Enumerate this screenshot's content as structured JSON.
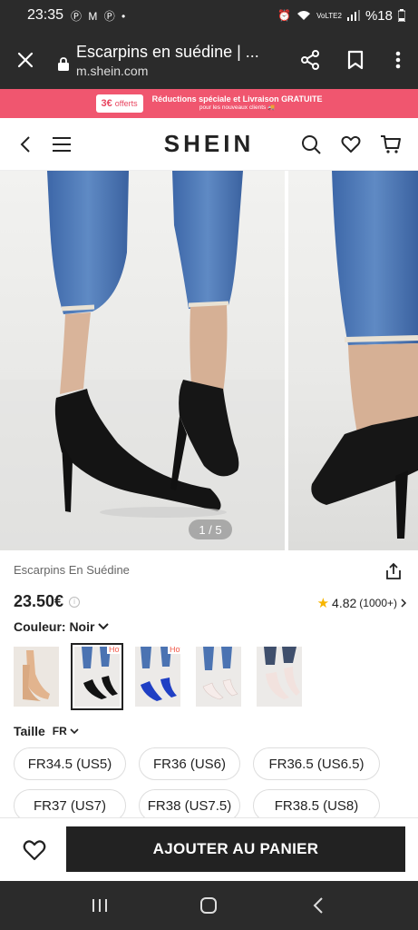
{
  "status_bar": {
    "time": "23:35",
    "notifications": "Ⓟ M Ⓟ •",
    "network": "VoLTE2",
    "battery": "%18"
  },
  "browser": {
    "page_title": "Escarpins en suédine | ...",
    "url": "m.shein.com"
  },
  "promo": {
    "badge_amount": "3€",
    "badge_text": "offerts",
    "line1": "Réductions spéciale et Livraison GRATUITE",
    "line2": "pour les nouveaux clients"
  },
  "header": {
    "brand": "SHEIN"
  },
  "gallery": {
    "counter": "1 / 5"
  },
  "product": {
    "title": "Escarpins En Suédine",
    "price": "23.50€",
    "info_icon": "i",
    "rating": "4.82",
    "rating_count": "(1000+)",
    "color_label": "Couleur: Noir",
    "swatches": [
      {
        "name": "nude",
        "hot": ""
      },
      {
        "name": "black",
        "hot": "Hot"
      },
      {
        "name": "blue",
        "hot": "Hot"
      },
      {
        "name": "white",
        "hot": ""
      },
      {
        "name": "pale-pink",
        "hot": ""
      }
    ],
    "size_label": "Taille",
    "size_system": "FR",
    "sizes": [
      "FR34.5 (US5)",
      "FR36 (US6)",
      "FR36.5 (US6.5)",
      "FR37 (US7)",
      "FR38 (US7.5)",
      "FR38.5 (US8)"
    ]
  },
  "actions": {
    "add_to_cart": "AJOUTER AU PANIER"
  },
  "colors": {
    "promo_bg": "#f0566f",
    "dark": "#222222",
    "system_bar": "#2b2b2b",
    "star": "#f7b500",
    "hot": "#f15a4a"
  }
}
